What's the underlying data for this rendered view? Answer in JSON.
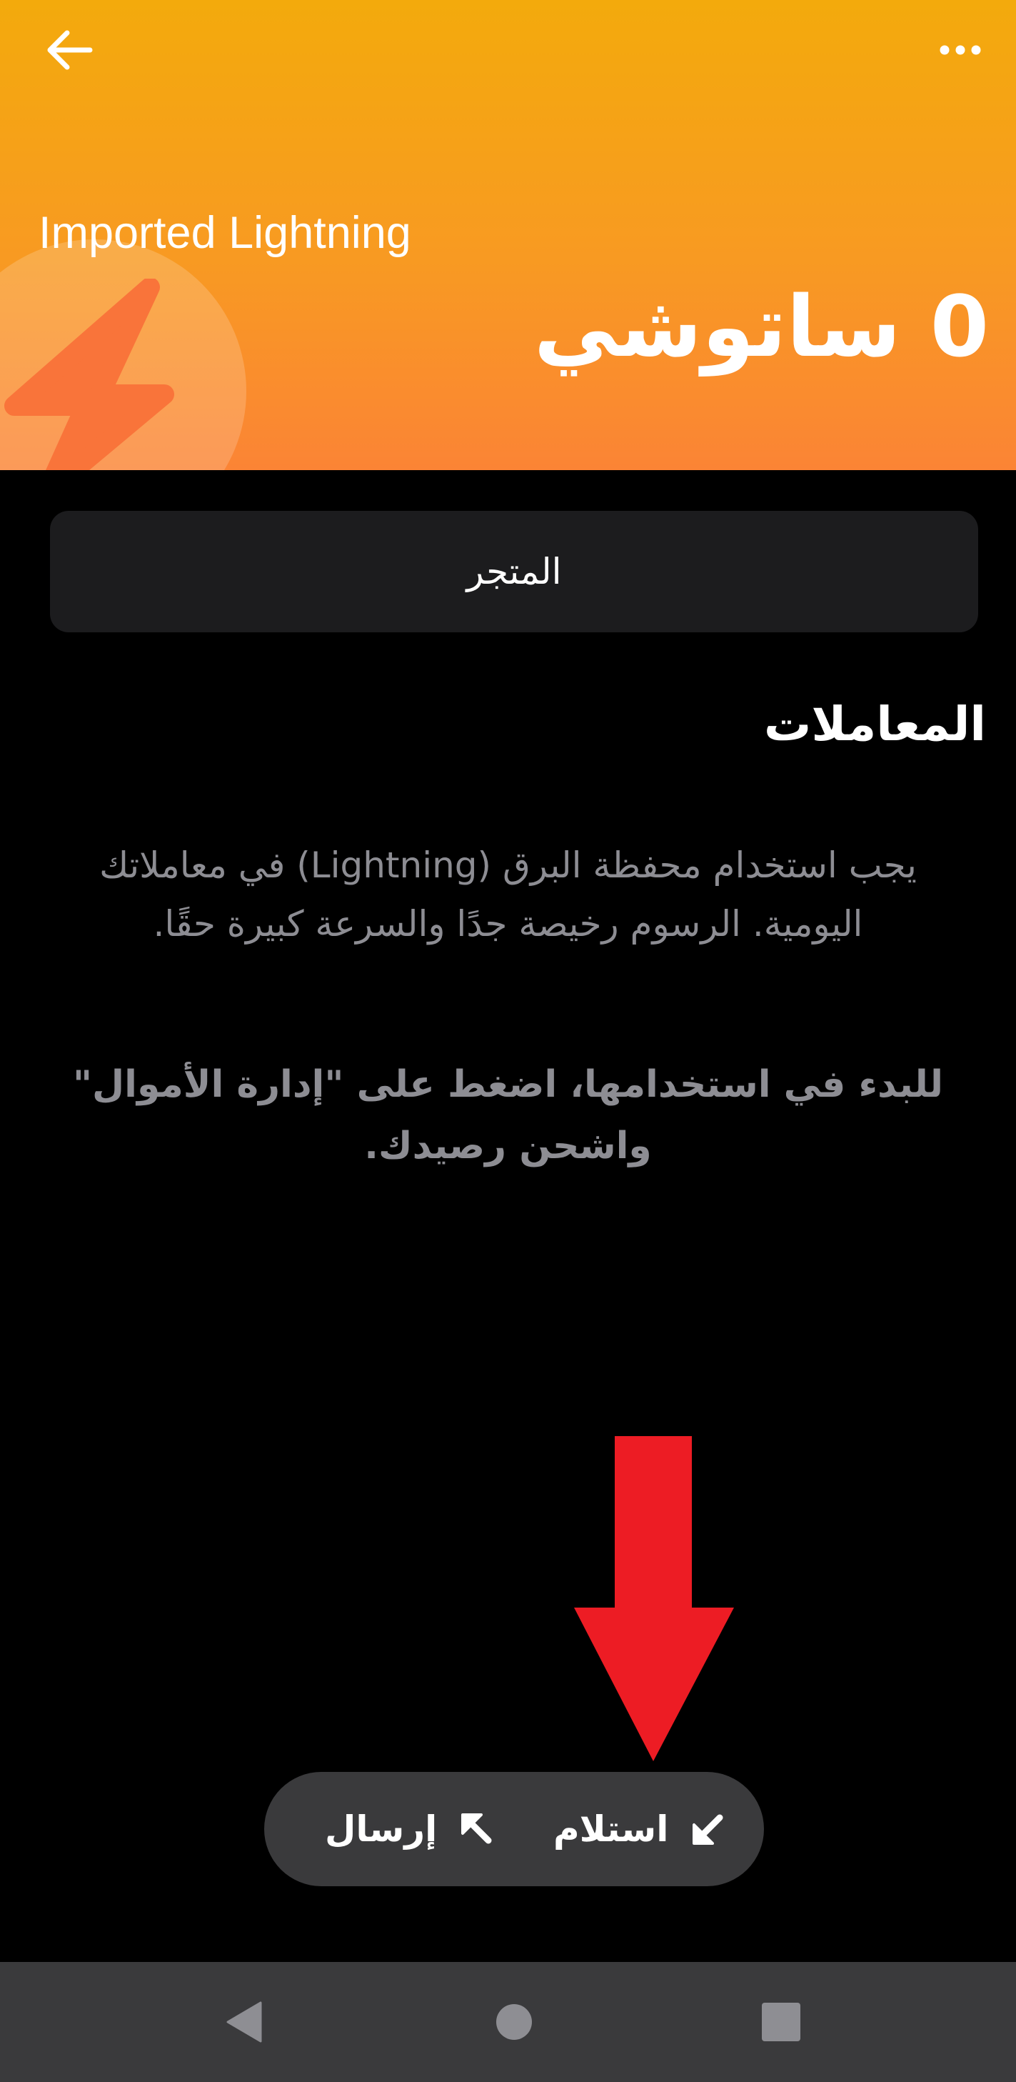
{
  "header": {
    "wallet_name": "Imported Lightning",
    "balance": "0 ساتوشي",
    "back_icon": "arrow-left-icon",
    "more_icon": "more-horizontal-icon",
    "bolt_icon": "lightning-bolt-icon",
    "gradient_top": "#F3AA0C",
    "gradient_bottom": "#FB8435"
  },
  "store": {
    "label": "المتجر"
  },
  "transactions": {
    "title": "المعاملات",
    "info": "يجب استخدام محفظة البرق (Lightning) في معاملاتك اليومية. الرسوم رخيصة جدًا والسرعة كبيرة حقًا.",
    "start_hint": "للبدء في استخدامها، اضغط على \"إدارة الأموال\" واشحن رصيدك."
  },
  "annotation": {
    "arrow_color": "#ED1C24",
    "arrow_icon": "red-down-arrow"
  },
  "actions": {
    "receive_label": "استلام",
    "send_label": "إرسال",
    "receive_icon": "arrow-down-left-icon",
    "send_icon": "arrow-up-left-icon"
  },
  "system_nav": {
    "back_icon": "triangle-back-icon",
    "home_icon": "circle-home-icon",
    "recents_icon": "square-recents-icon"
  }
}
